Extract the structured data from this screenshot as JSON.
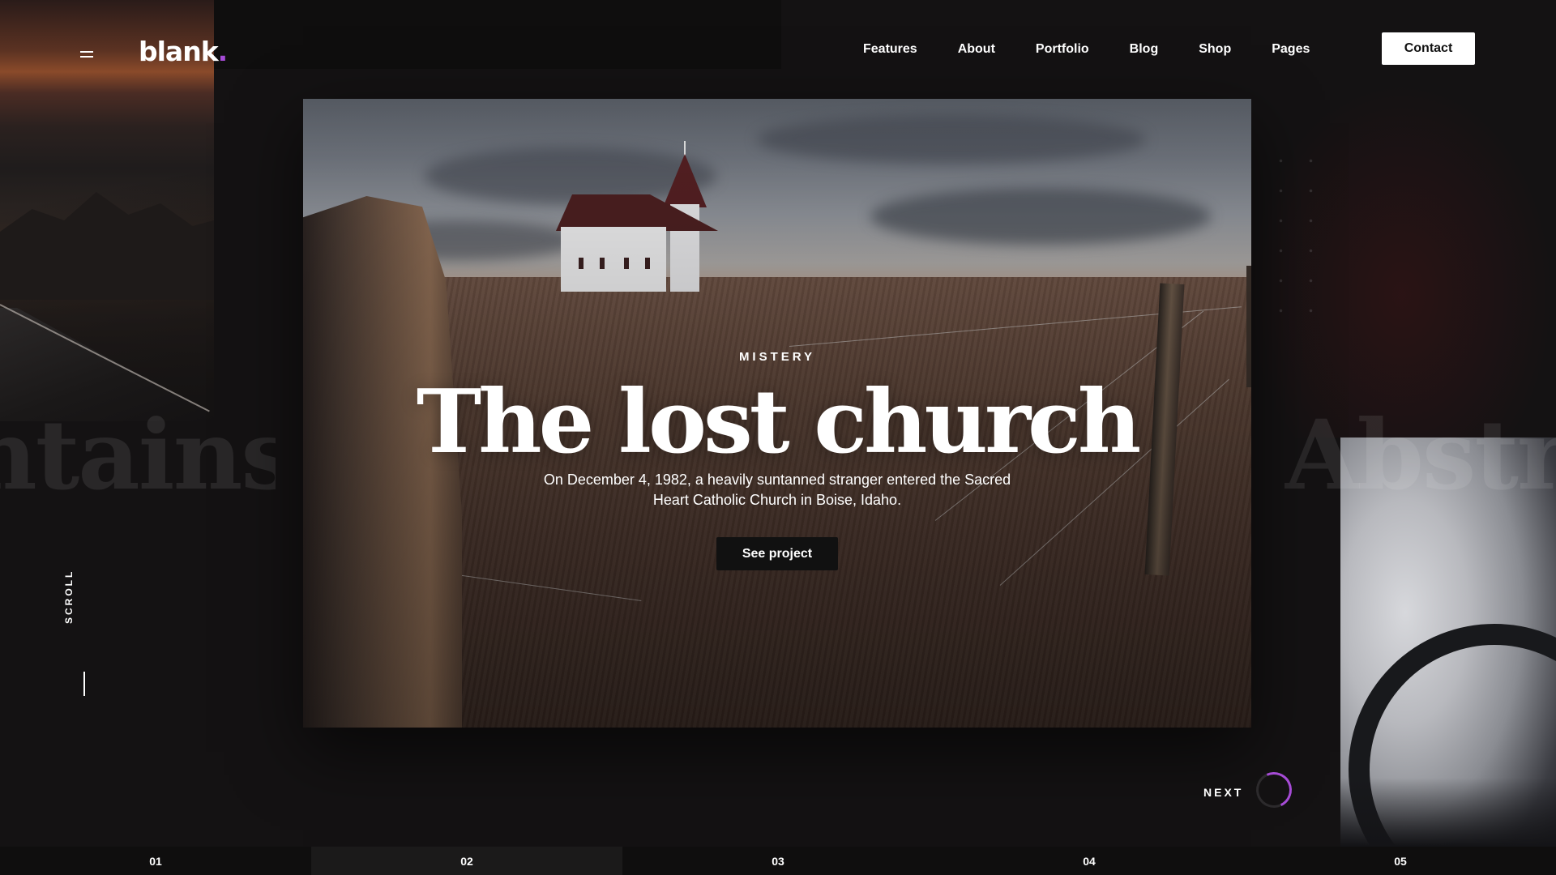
{
  "brand": {
    "name": "blank",
    "dot": ".",
    "accent_color": "#a64bd6"
  },
  "nav": {
    "items": [
      {
        "label": "Features"
      },
      {
        "label": "About"
      },
      {
        "label": "Portfolio"
      },
      {
        "label": "Blog"
      },
      {
        "label": "Shop"
      },
      {
        "label": "Pages"
      }
    ],
    "contact_label": "Contact"
  },
  "hero": {
    "eyebrow": "MISTERY",
    "title": "The lost church",
    "description": "On December 4, 1982, a heavily suntanned stranger entered the Sacred Heart Catholic Church in Boise, Idaho.",
    "cta_label": "See project"
  },
  "background": {
    "prev_word": "ntains",
    "next_word": "Abstra"
  },
  "scroll": {
    "label": "SCROLL"
  },
  "next": {
    "label": "NEXT"
  },
  "slides": [
    {
      "index": "01"
    },
    {
      "index": "02"
    },
    {
      "index": "03"
    },
    {
      "index": "04"
    },
    {
      "index": "05"
    }
  ],
  "icons": {
    "menu": "hamburger-icon",
    "next": "progress-ring-icon"
  }
}
